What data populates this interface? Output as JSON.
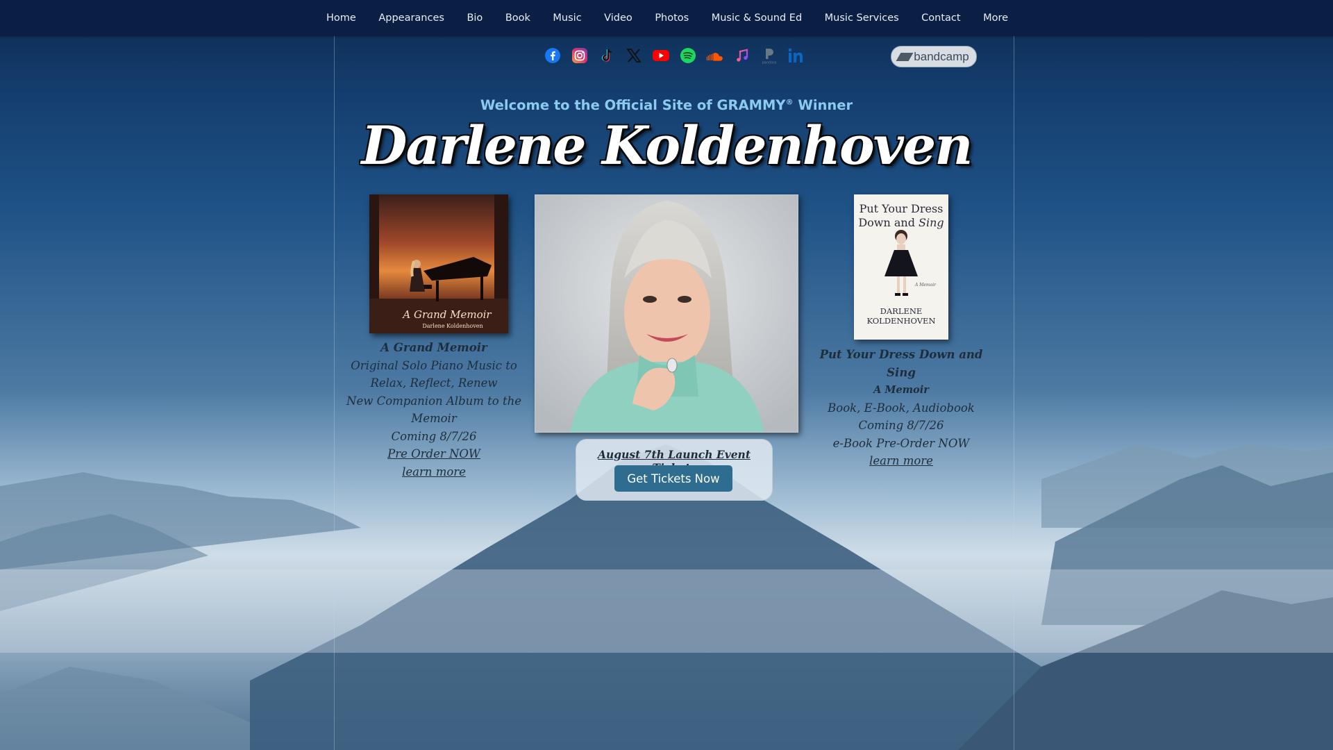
{
  "nav": {
    "items": [
      "Home",
      "Appearances",
      "Bio",
      "Book",
      "Music",
      "Video",
      "Photos",
      "Music & Sound Ed",
      "Music Services",
      "Contact",
      "More"
    ]
  },
  "social": {
    "icons": [
      "facebook-icon",
      "instagram-icon",
      "tiktok-icon",
      "x-icon",
      "youtube-icon",
      "spotify-icon",
      "soundcloud-icon",
      "apple-music-icon",
      "pandora-icon",
      "linkedin-icon"
    ],
    "bandcamp_label": "bandcamp"
  },
  "header": {
    "welcome": "Welcome to the Official Site of GRAMMY",
    "welcome_mark": "®",
    "welcome_end": " Winner",
    "artist": "Darlene Koldenhoven"
  },
  "album": {
    "cover_title": "A Grand Memoir",
    "cover_artist": "Darlene Koldenhoven",
    "title": "A Grand Memoir",
    "line1": "Original Solo Piano Music to",
    "line2": "Relax, Reflect, Renew",
    "line3": "New Companion Album to the Memoir",
    "line4": "Coming 8/7/26",
    "preorder_link": "Pre Order NOW",
    "learn_link": "learn more"
  },
  "launch": {
    "link": "August 7th Launch Event Tickets",
    "button": "Get Tickets Now"
  },
  "book": {
    "cover_title_1": "Put Your Dress",
    "cover_title_2": "Down and ",
    "cover_title_3": "Sing",
    "cover_subtitle": "A Memoir",
    "cover_author_1": "DARLENE",
    "cover_author_2": "KOLDENHOVEN",
    "title": "Put Your Dress Down and Sing",
    "subtitle": "A Memoir",
    "line1": "Book, E-Book, Audiobook",
    "line2": "Coming 8/7/26",
    "line3": "e-Book Pre-Order NOW",
    "learn_link": "learn more"
  },
  "colors": {
    "nav_bg": "#0b1f45",
    "welcome_text": "#8ccbf0",
    "button_bg": "#2e6d8f"
  }
}
